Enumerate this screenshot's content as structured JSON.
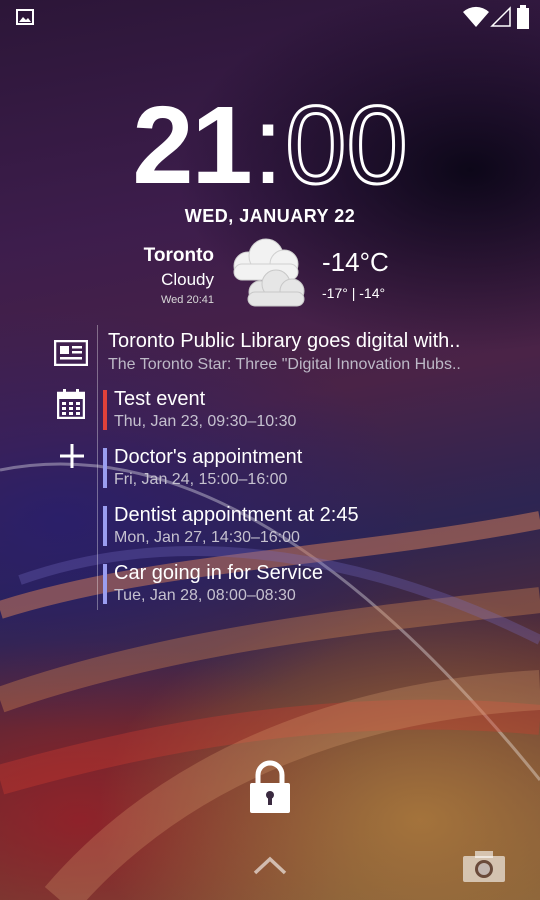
{
  "status_bar": {
    "left_icon": "gallery-icon",
    "right_icons": [
      "wifi-icon",
      "signal-icon",
      "battery-icon"
    ]
  },
  "clock": {
    "hours": "21",
    "separator": ":",
    "minutes": "00",
    "date": "WED, JANUARY 22"
  },
  "weather": {
    "city": "Toronto",
    "condition": "Cloudy",
    "updated": "Wed 20:41",
    "temperature": "-14°C",
    "range": "-17° | -14°",
    "icon": "cloudy-icon"
  },
  "news": {
    "title": "Toronto Public Library goes digital with..",
    "subtitle": "The Toronto Star: Three \"Digital Innovation Hubs.."
  },
  "events": [
    {
      "title": "Test event",
      "time": "Thu, Jan 23, 09:30–10:30",
      "color": "#e0413a"
    },
    {
      "title": "Doctor's appointment",
      "time": "Fri, Jan 24, 15:00–16:00",
      "color": "#9a9df0"
    },
    {
      "title": "Dentist appointment at 2:45",
      "time": "Mon, Jan 27, 14:30–16:00",
      "color": "#9a9df0"
    },
    {
      "title": "Car going in for Service",
      "time": "Tue, Jan 28, 08:00–08:30",
      "color": "#9a9df0"
    }
  ],
  "side_icons": [
    "news-icon",
    "calendar-icon",
    "add-icon"
  ],
  "bottom": {
    "icons": [
      "lock-icon",
      "chevron-up-icon",
      "camera-icon"
    ]
  }
}
